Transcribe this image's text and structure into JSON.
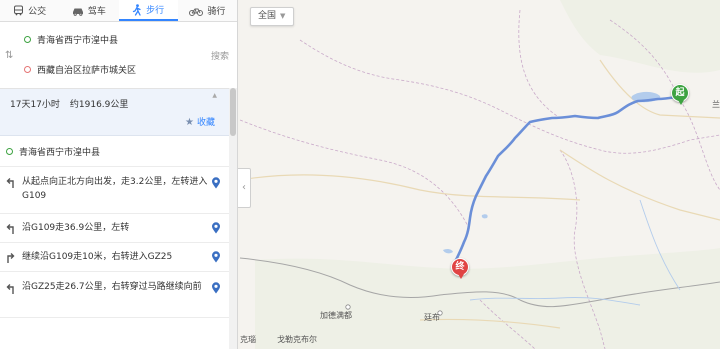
{
  "tabs": [
    {
      "label": "公交",
      "icon": "bus-icon"
    },
    {
      "label": "驾车",
      "icon": "car-icon"
    },
    {
      "label": "步行",
      "icon": "walking-icon",
      "active": true
    },
    {
      "label": "骑行",
      "icon": "bicycle-icon"
    }
  ],
  "route": {
    "from": "青海省西宁市湟中县",
    "to": "西藏自治区拉萨市城关区",
    "search_label": "搜索"
  },
  "summary": {
    "duration": "17天17小时",
    "distance": "约1916.9公里",
    "favorite_label": "收藏"
  },
  "steps": {
    "start": "青海省西宁市湟中县",
    "items": [
      {
        "text": "从起点向正北方向出发，走3.2公里，左转进入G109",
        "turn": "left"
      },
      {
        "text": "沿G109走36.9公里，左转",
        "turn": "left"
      },
      {
        "text": "继续沿G109走10米，右转进入GZ25",
        "turn": "right"
      },
      {
        "text": "沿GZ25走26.7公里，右转穿过马路继续向前",
        "turn": "left"
      }
    ]
  },
  "map": {
    "region_label": "全国",
    "start_marker": "起",
    "end_marker": "终",
    "labels": {
      "jiade": "加德满都",
      "tingri": "廷布",
      "sri": "戈勒克布尔",
      "kekot": "克瑙",
      "edge": "兰"
    },
    "colors": {
      "route": "#6b8fd8",
      "start": "#3ea342",
      "end": "#e04444",
      "accent": "#3385ff"
    }
  }
}
